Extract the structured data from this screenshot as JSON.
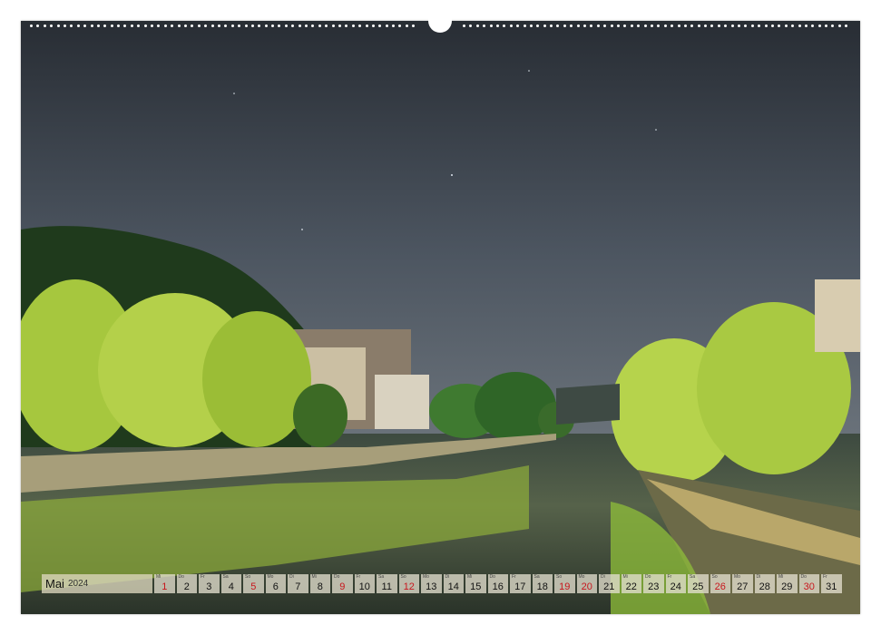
{
  "calendar": {
    "month": "Mai",
    "year": "2024",
    "days": [
      {
        "weekday": "Mi",
        "day": "1",
        "type": "holiday"
      },
      {
        "weekday": "Do",
        "day": "2",
        "type": "normal"
      },
      {
        "weekday": "Fr",
        "day": "3",
        "type": "normal"
      },
      {
        "weekday": "Sa",
        "day": "4",
        "type": "normal"
      },
      {
        "weekday": "So",
        "day": "5",
        "type": "sunday"
      },
      {
        "weekday": "Mo",
        "day": "6",
        "type": "normal"
      },
      {
        "weekday": "Di",
        "day": "7",
        "type": "normal"
      },
      {
        "weekday": "Mi",
        "day": "8",
        "type": "normal"
      },
      {
        "weekday": "Do",
        "day": "9",
        "type": "holiday"
      },
      {
        "weekday": "Fr",
        "day": "10",
        "type": "normal"
      },
      {
        "weekday": "Sa",
        "day": "11",
        "type": "normal"
      },
      {
        "weekday": "So",
        "day": "12",
        "type": "sunday"
      },
      {
        "weekday": "Mo",
        "day": "13",
        "type": "normal"
      },
      {
        "weekday": "Di",
        "day": "14",
        "type": "normal"
      },
      {
        "weekday": "Mi",
        "day": "15",
        "type": "normal"
      },
      {
        "weekday": "Do",
        "day": "16",
        "type": "normal"
      },
      {
        "weekday": "Fr",
        "day": "17",
        "type": "normal"
      },
      {
        "weekday": "Sa",
        "day": "18",
        "type": "normal"
      },
      {
        "weekday": "So",
        "day": "19",
        "type": "sunday"
      },
      {
        "weekday": "Mo",
        "day": "20",
        "type": "holiday"
      },
      {
        "weekday": "Di",
        "day": "21",
        "type": "normal"
      },
      {
        "weekday": "Mi",
        "day": "22",
        "type": "normal"
      },
      {
        "weekday": "Do",
        "day": "23",
        "type": "normal"
      },
      {
        "weekday": "Fr",
        "day": "24",
        "type": "normal"
      },
      {
        "weekday": "Sa",
        "day": "25",
        "type": "normal"
      },
      {
        "weekday": "So",
        "day": "26",
        "type": "sunday"
      },
      {
        "weekday": "Mo",
        "day": "27",
        "type": "normal"
      },
      {
        "weekday": "Di",
        "day": "28",
        "type": "normal"
      },
      {
        "weekday": "Mi",
        "day": "29",
        "type": "normal"
      },
      {
        "weekday": "Do",
        "day": "30",
        "type": "holiday"
      },
      {
        "weekday": "Fr",
        "day": "31",
        "type": "normal"
      }
    ]
  },
  "colors": {
    "sky_top": "#2c3138",
    "sky_bottom": "#5a6470",
    "foliage": "#9fc23a",
    "water": "#2e3a32",
    "holiday_red": "#c8161d"
  },
  "photo_subject": "night-river-townscape-image"
}
